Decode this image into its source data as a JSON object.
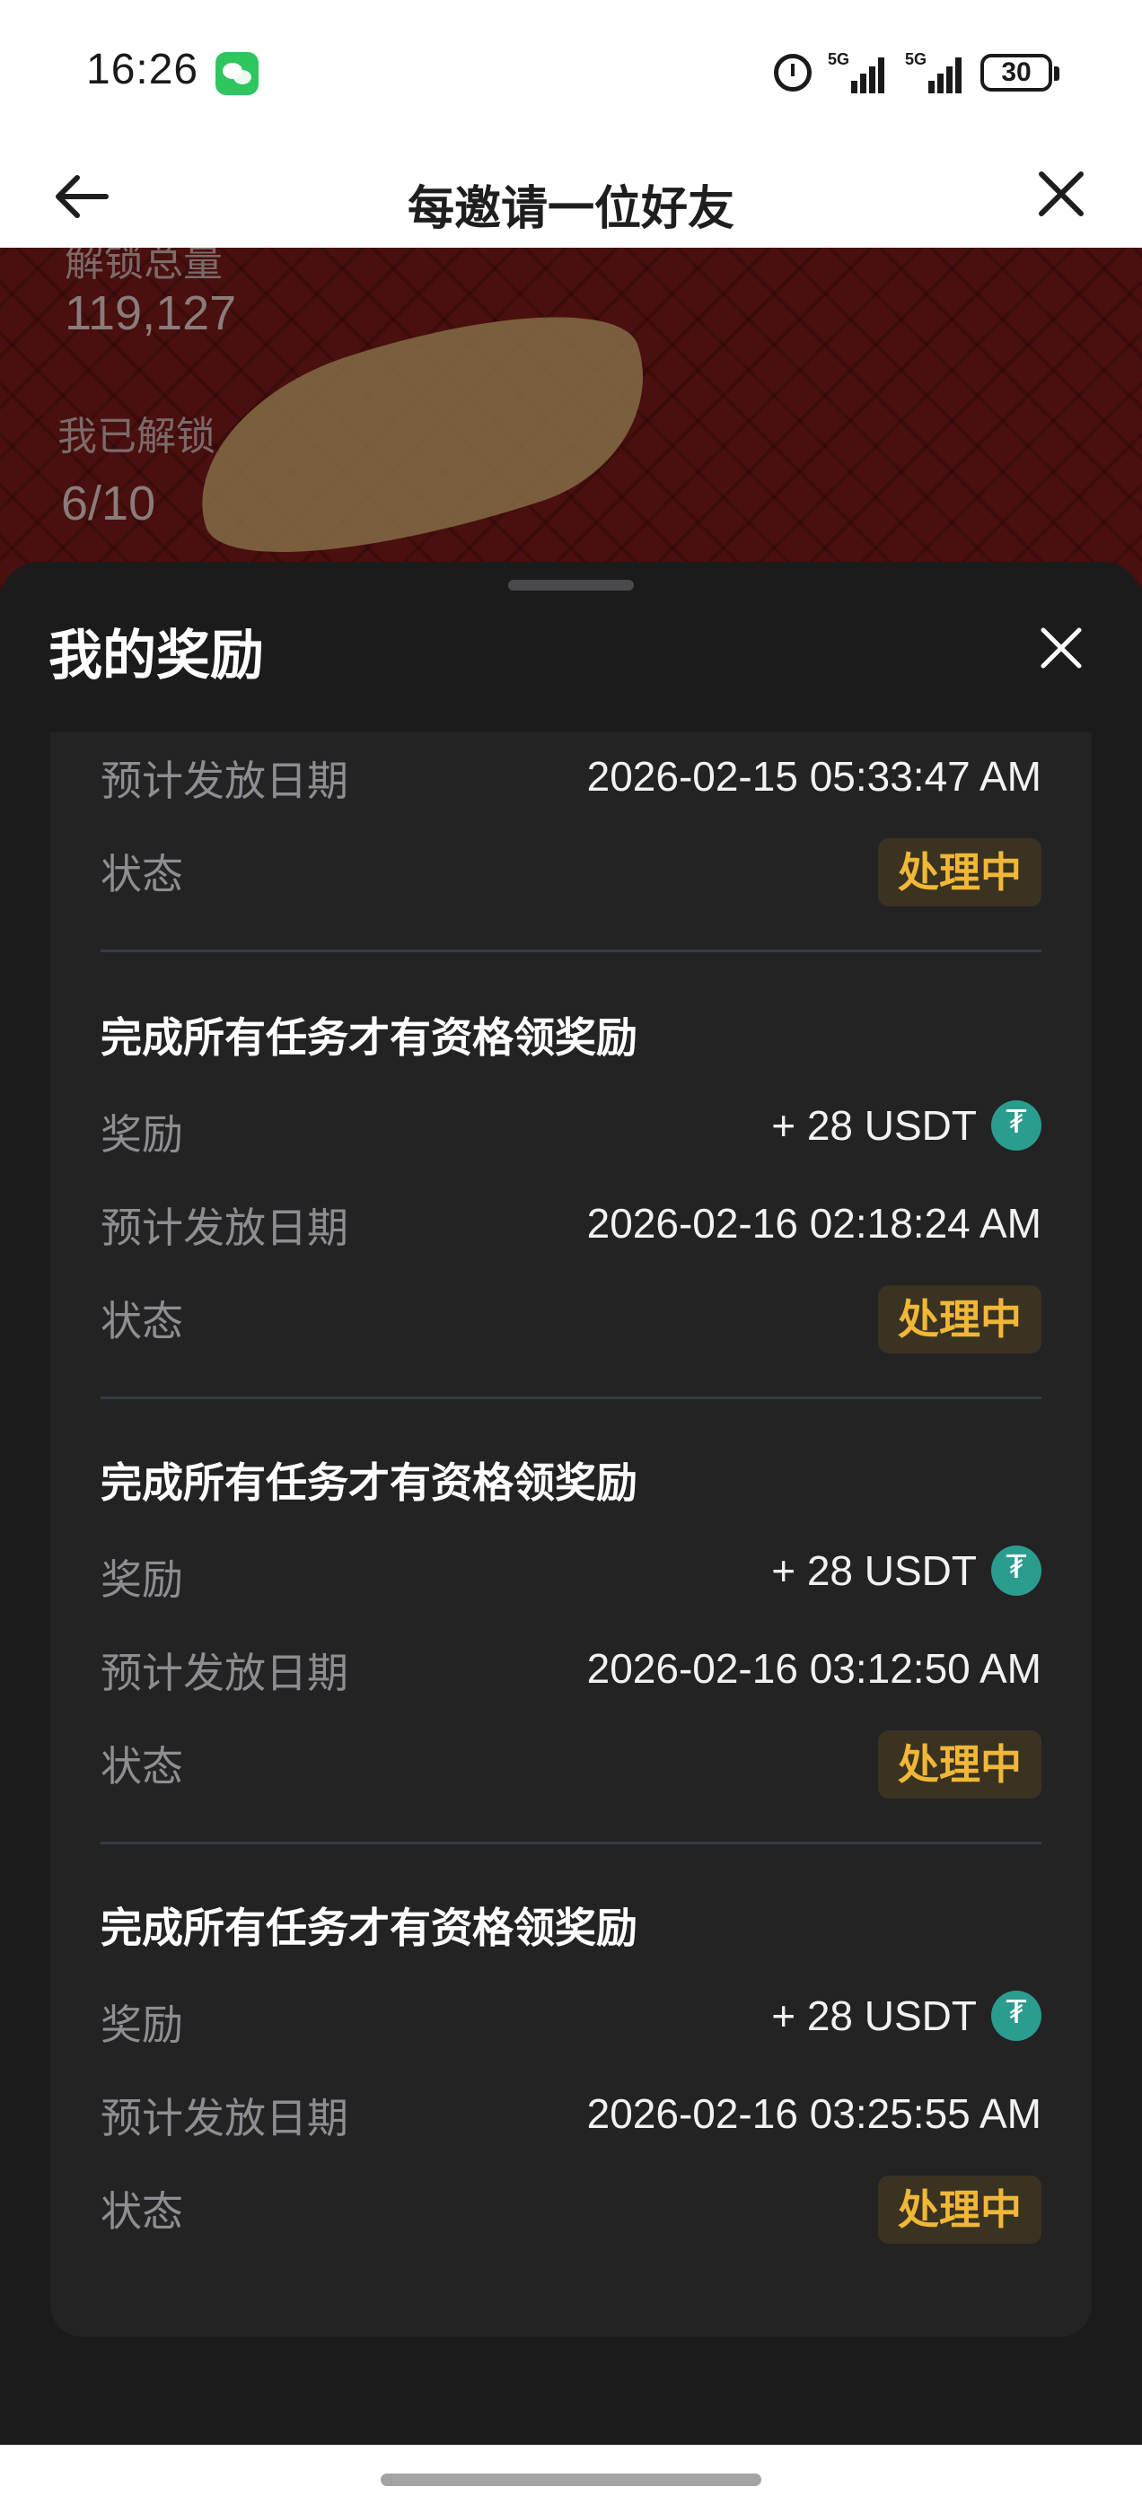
{
  "status_bar": {
    "time": "16:26",
    "battery": "30",
    "signal_1": "5G",
    "signal_2": "5G"
  },
  "nav": {
    "title": "每邀请一位好友"
  },
  "banner": {
    "total_label": "解锁总量",
    "total_value": "119,127",
    "mine_label": "我已解锁",
    "mine_value": "6/10"
  },
  "sheet": {
    "title": "我的奖励"
  },
  "partial_item": {
    "date_label": "预计发放日期",
    "date_value": "2026-02-15 05:33:47 AM",
    "status_label": "状态",
    "status_value": "处理中"
  },
  "items": [
    {
      "title": "完成所有任务才有资格领奖励",
      "reward_label": "奖励",
      "reward_value": "+ 28 USDT",
      "date_label": "预计发放日期",
      "date_value": "2026-02-16 02:18:24 AM",
      "status_label": "状态",
      "status_value": "处理中"
    },
    {
      "title": "完成所有任务才有资格领奖励",
      "reward_label": "奖励",
      "reward_value": "+ 28 USDT",
      "date_label": "预计发放日期",
      "date_value": "2026-02-16 03:12:50 AM",
      "status_label": "状态",
      "status_value": "处理中"
    },
    {
      "title": "完成所有任务才有资格领奖励",
      "reward_label": "奖励",
      "reward_value": "+ 28 USDT",
      "date_label": "预计发放日期",
      "date_value": "2026-02-16 03:25:55 AM",
      "status_label": "状态",
      "status_value": "处理中"
    }
  ],
  "colors": {
    "accent_status": "#f1b736",
    "usdt": "#2a9d8f",
    "banner_red": "#4a0f0f"
  }
}
